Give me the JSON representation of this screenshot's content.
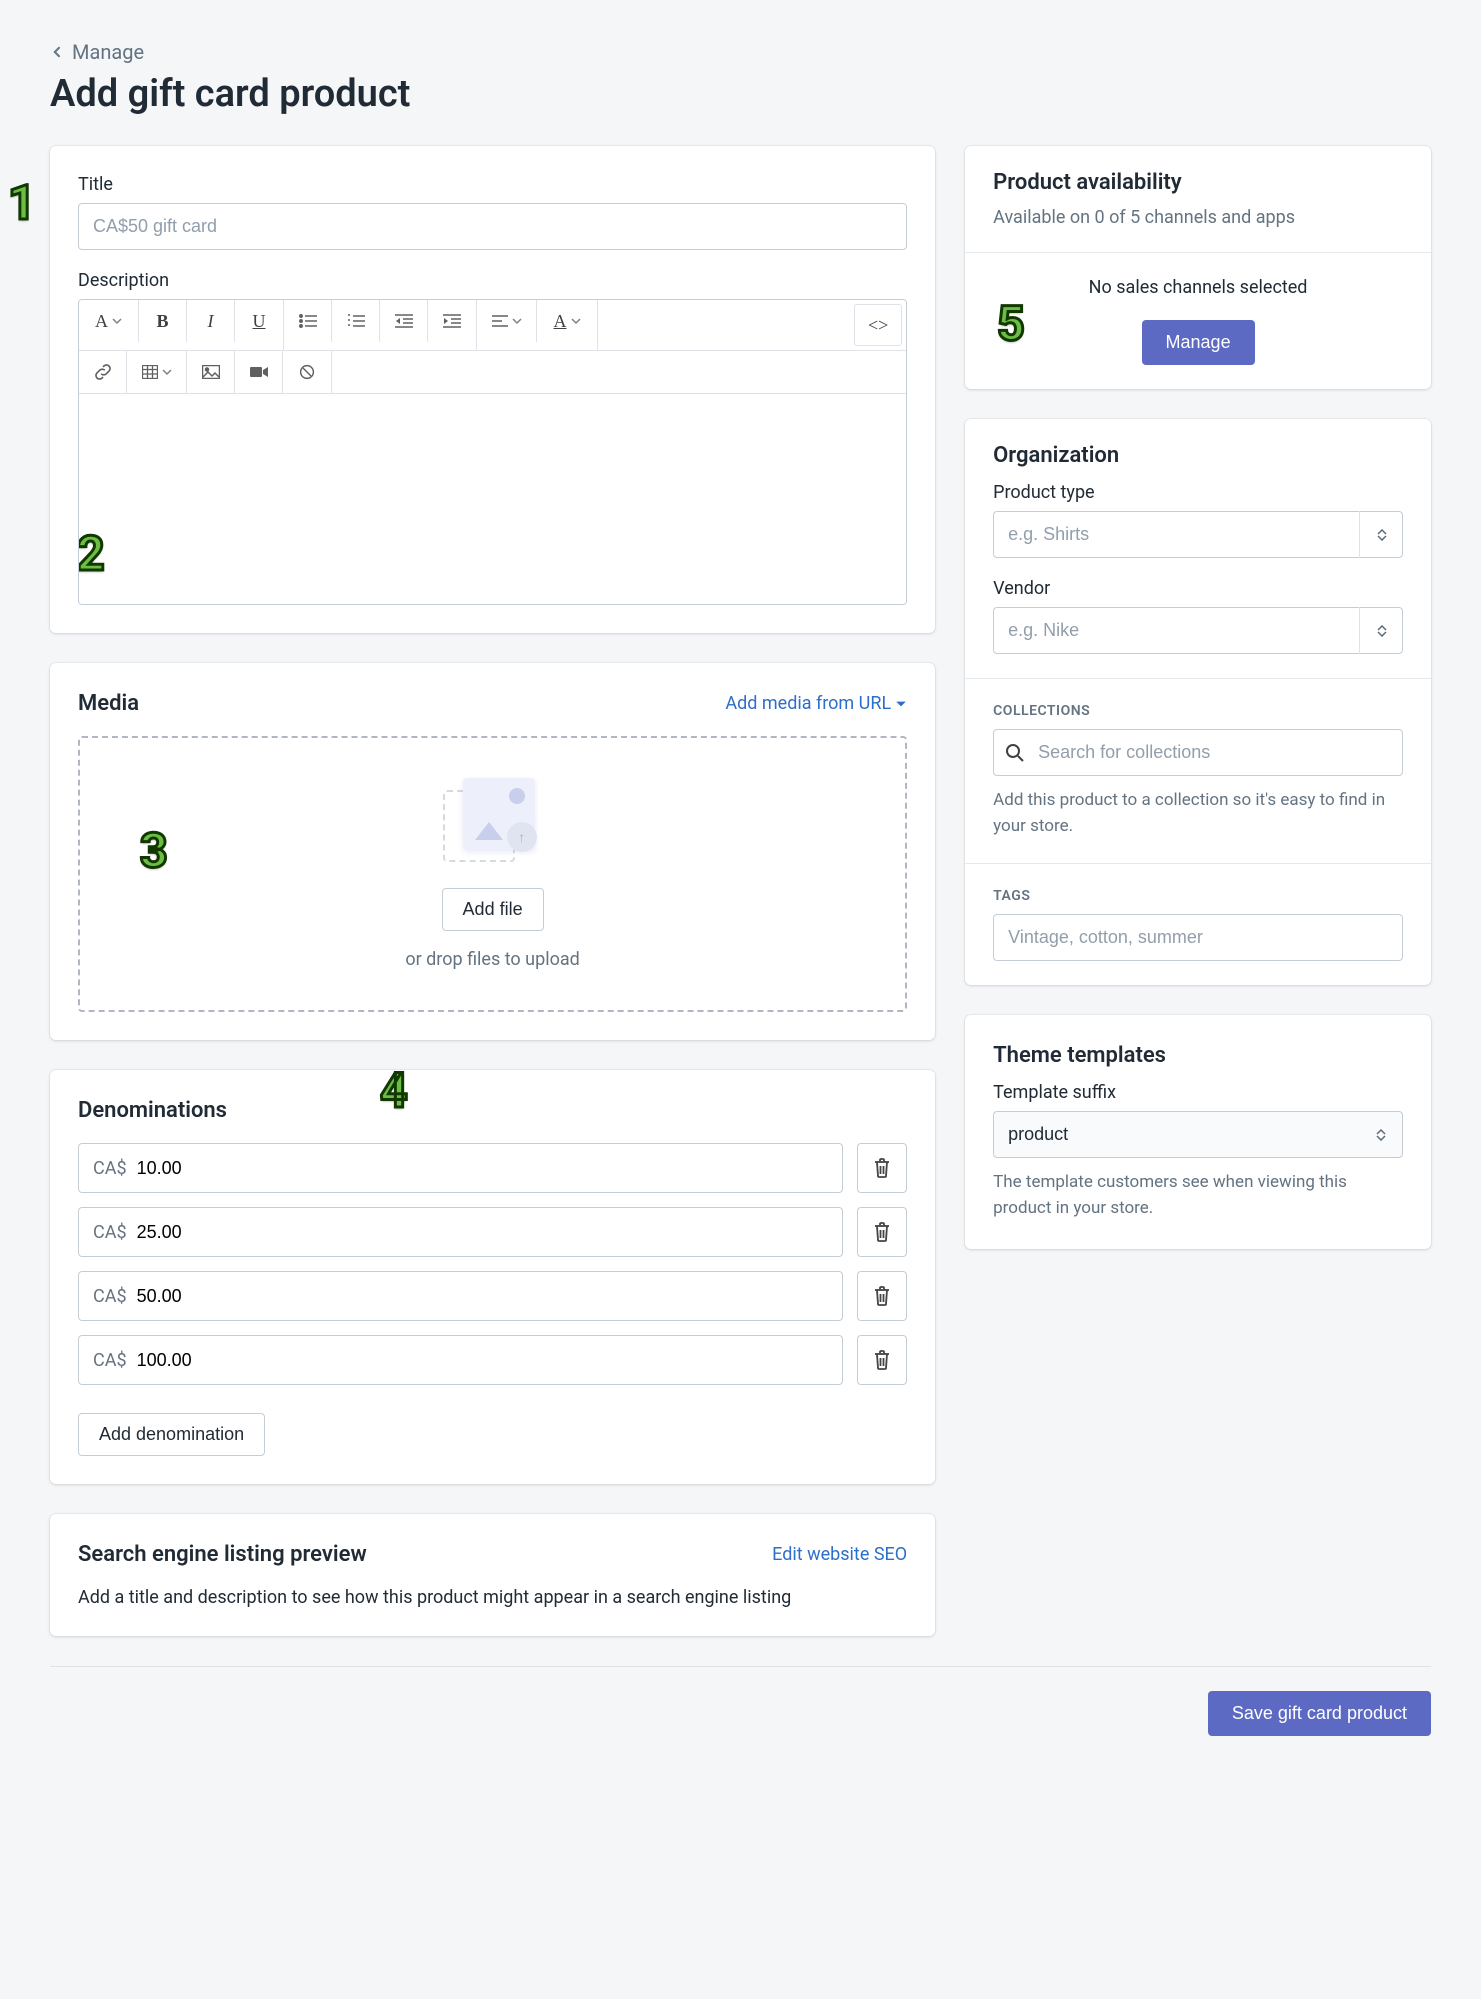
{
  "breadcrumb": {
    "label": "Manage"
  },
  "page": {
    "title": "Add gift card product"
  },
  "callouts": [
    "1",
    "2",
    "3",
    "4",
    "5"
  ],
  "form": {
    "title_label": "Title",
    "title_placeholder": "CA$50 gift card",
    "description_label": "Description"
  },
  "media": {
    "heading": "Media",
    "add_url": "Add media from URL",
    "add_file": "Add file",
    "drop_text": "or drop files to upload"
  },
  "denominations": {
    "heading": "Denominations",
    "currency": "CA$",
    "values": [
      "10.00",
      "25.00",
      "50.00",
      "100.00"
    ],
    "add_label": "Add denomination"
  },
  "seo": {
    "heading": "Search engine listing preview",
    "edit_link": "Edit website SEO",
    "helper": "Add a title and description to see how this product might appear in a search engine listing"
  },
  "availability": {
    "heading": "Product availability",
    "subtitle": "Available on 0 of 5 channels and apps",
    "none_selected": "No sales channels selected",
    "manage_btn": "Manage"
  },
  "organization": {
    "heading": "Organization",
    "product_type_label": "Product type",
    "product_type_placeholder": "e.g. Shirts",
    "vendor_label": "Vendor",
    "vendor_placeholder": "e.g. Nike",
    "collections_label": "COLLECTIONS",
    "collections_placeholder": "Search for collections",
    "collections_helper": "Add this product to a collection so it's easy to find in your store.",
    "tags_label": "TAGS",
    "tags_placeholder": "Vintage, cotton, summer"
  },
  "theme": {
    "heading": "Theme templates",
    "suffix_label": "Template suffix",
    "suffix_value": "product",
    "helper": "The template customers see when viewing this product in your store."
  },
  "footer": {
    "save_label": "Save gift card product"
  }
}
